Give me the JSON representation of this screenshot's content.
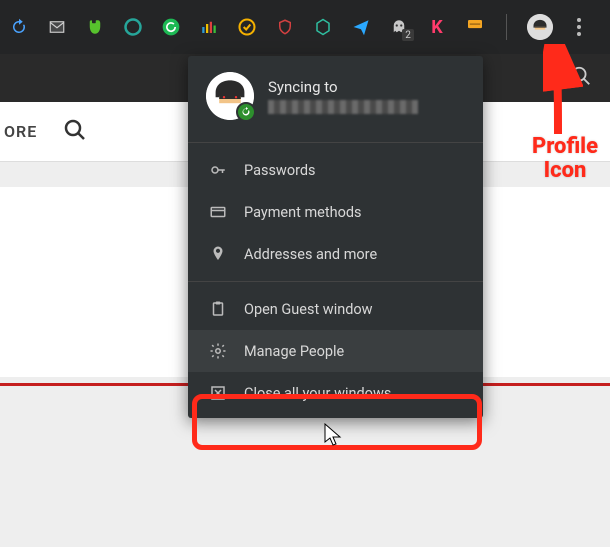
{
  "toolbar": {
    "icons": [
      {
        "name": "sync-icon",
        "color": "#4aa3ff"
      },
      {
        "name": "mail-icon",
        "color": "#d0d0d0"
      },
      {
        "name": "evernote-icon",
        "color": "#57c22d"
      },
      {
        "name": "circle-icon",
        "color": "#26a69a"
      },
      {
        "name": "grammarly-icon",
        "color": "#1db954"
      },
      {
        "name": "bars-icon",
        "color": "#f0c000"
      },
      {
        "name": "check-icon",
        "color": "#f5b100"
      },
      {
        "name": "shield-icon",
        "color": "#d24040"
      },
      {
        "name": "hexagon-icon",
        "color": "#2fbfa0"
      },
      {
        "name": "paperplane-icon",
        "color": "#2aa8ff"
      },
      {
        "name": "ghost-icon",
        "color": "#c8c8c8",
        "badge": "2"
      },
      {
        "name": "k-icon",
        "color": "#ff3b6b",
        "glyph": "K"
      },
      {
        "name": "card-icon",
        "color": "#f5a623"
      }
    ]
  },
  "tabbar": {
    "explore_label": "ORE"
  },
  "dropdown": {
    "sync_title": "Syncing to",
    "items": {
      "passwords": "Passwords",
      "payment": "Payment methods",
      "addresses": "Addresses and more",
      "guest": "Open Guest window",
      "manage": "Manage People",
      "close": "Close all your windows"
    }
  },
  "callout": {
    "profile": "Profile Icon"
  }
}
